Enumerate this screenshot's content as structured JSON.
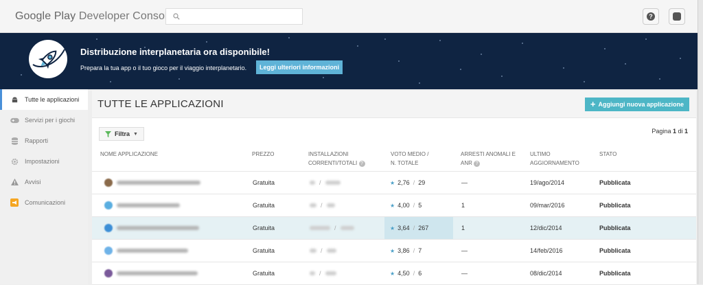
{
  "header": {
    "brand_main": "Google Play",
    "brand_sub": "Developer Console",
    "search_placeholder": "",
    "help_icon": "help-icon",
    "account_icon": "account-icon"
  },
  "banner": {
    "title": "Distribuzione interplanetaria ora disponibile!",
    "subtitle": "Prepara la tua app o il tuo gioco per il viaggio interplanetario.",
    "button": "Leggi ulteriori informazioni"
  },
  "sidebar": {
    "items": [
      {
        "label": "Tutte le applicazioni",
        "icon": "android-icon",
        "active": true
      },
      {
        "label": "Servizi per i giochi",
        "icon": "gamepad-icon",
        "active": false
      },
      {
        "label": "Rapporti",
        "icon": "database-icon",
        "active": false
      },
      {
        "label": "Impostazioni",
        "icon": "gear-icon",
        "active": false
      },
      {
        "label": "Avvisi",
        "icon": "warning-icon",
        "active": false
      },
      {
        "label": "Comunicazioni",
        "icon": "megaphone-icon",
        "active": false
      }
    ]
  },
  "main": {
    "title": "TUTTE LE APPLICAZIONI",
    "add_button": "Aggiungi nuova applicazione",
    "filter_label": "Filtra",
    "pager_prefix": "Pagina ",
    "pager_current": "1",
    "pager_mid": " di ",
    "pager_total": "1"
  },
  "table": {
    "headers": {
      "name": "NOME APPLICAZIONE",
      "price": "PREZZO",
      "installs_l1": "INSTALLAZIONI",
      "installs_l2": "CORRENTI/TOTALI",
      "rating_l1": "VOTO MEDIO /",
      "rating_l2": "N. TOTALE",
      "crashes_l1": "ARRESTI ANOMALI E",
      "crashes_l2": "ANR",
      "updated_l1": "ULTIMO",
      "updated_l2": "AGGIORNAMENTO",
      "status": "STATO"
    },
    "rows": [
      {
        "price": "Gratuita",
        "rating": "2,76",
        "rating_count": "29",
        "crashes": "—",
        "updated": "19/ago/2014",
        "status": "Pubblicata",
        "icon_color": "#8a6a4a"
      },
      {
        "price": "Gratuita",
        "rating": "4,00",
        "rating_count": "5",
        "crashes": "1",
        "updated": "09/mar/2016",
        "status": "Pubblicata",
        "icon_color": "#5aaee0"
      },
      {
        "price": "Gratuita",
        "rating": "3,64",
        "rating_count": "267",
        "crashes": "1",
        "updated": "12/dic/2014",
        "status": "Pubblicata",
        "icon_color": "#3d8fd6"
      },
      {
        "price": "Gratuita",
        "rating": "3,86",
        "rating_count": "7",
        "crashes": "—",
        "updated": "14/feb/2016",
        "status": "Pubblicata",
        "icon_color": "#6fb3e8"
      },
      {
        "price": "Gratuita",
        "rating": "4,50",
        "rating_count": "6",
        "crashes": "—",
        "updated": "08/dic/2014",
        "status": "Pubblicata",
        "icon_color": "#7a5a9a"
      }
    ]
  },
  "colors": {
    "accent": "#4db6c6",
    "banner_bg": "#0f2442",
    "banner_button": "#5fb3d7",
    "selected_row": "#e5f1f4"
  }
}
